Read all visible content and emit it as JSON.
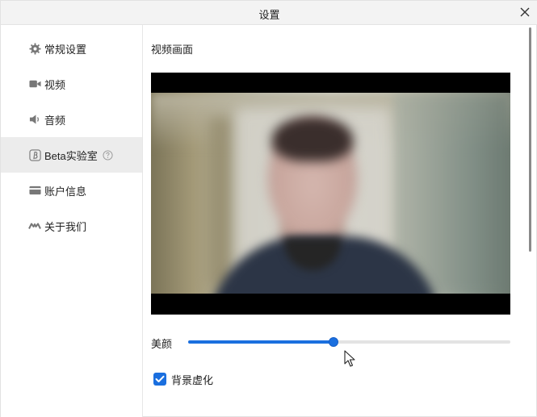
{
  "window": {
    "title": "设置"
  },
  "sidebar": {
    "items": [
      {
        "label": "常规设置",
        "icon": "gear-icon",
        "active": false
      },
      {
        "label": "视频",
        "icon": "video-camera-icon",
        "active": false
      },
      {
        "label": "音频",
        "icon": "speaker-icon",
        "active": false
      },
      {
        "label": "Beta实验室",
        "icon": "beta-icon",
        "active": true,
        "help_icon": "question-circle-icon"
      },
      {
        "label": "账户信息",
        "icon": "card-icon",
        "active": false
      },
      {
        "label": "关于我们",
        "icon": "about-logo-icon",
        "active": false
      }
    ]
  },
  "main": {
    "section_title": "视频画面",
    "beauty": {
      "label": "美颜",
      "value_fraction": 0.45
    },
    "background_blur": {
      "label": "背景虚化",
      "checked": true
    }
  },
  "colors": {
    "accent": "#1a6fdf",
    "active_bg": "#ececec",
    "titlebar_bg": "#f3f3f3"
  }
}
